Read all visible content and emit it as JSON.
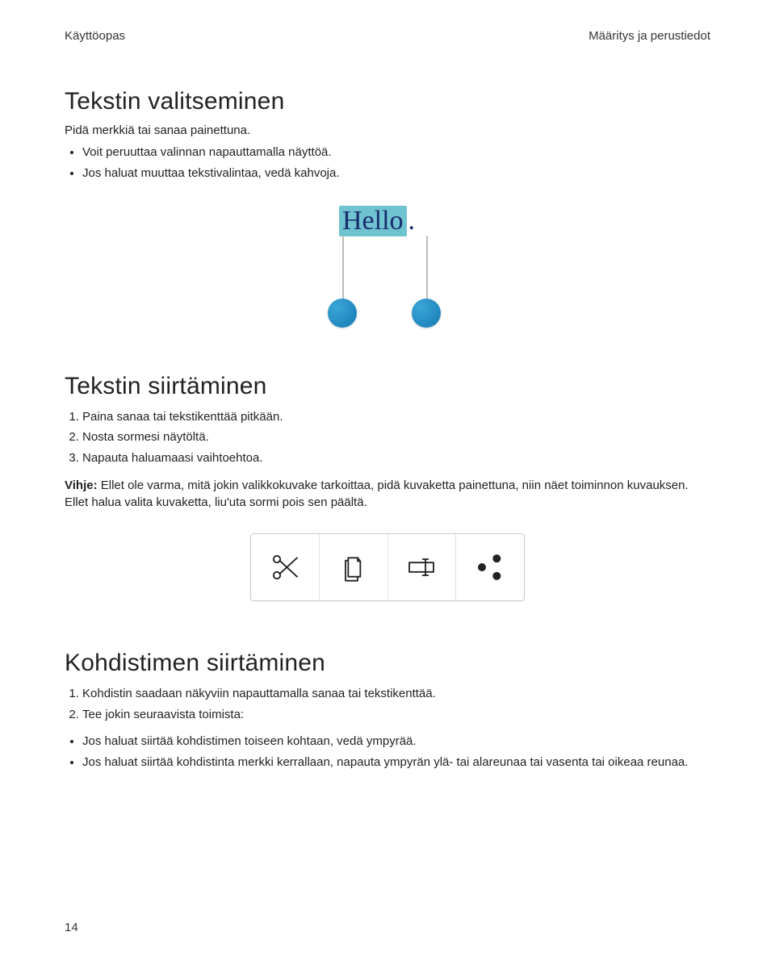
{
  "header": {
    "left": "Käyttöopas",
    "right": "Määritys ja perustiedot"
  },
  "page_number": "14",
  "sec1": {
    "title": "Tekstin valitseminen",
    "lead": "Pidä merkkiä tai sanaa painettuna.",
    "b1": "Voit peruuttaa valinnan napauttamalla näyttöä.",
    "b2": "Jos haluat muuttaa tekstivalintaa, vedä kahvoja."
  },
  "fig_hello": {
    "text": "Hello",
    "dot": "."
  },
  "sec2": {
    "title": "Tekstin siirtäminen",
    "s1": "Paina sanaa tai tekstikenttää pitkään.",
    "s2": "Nosta sormesi näytöltä.",
    "s3": "Napauta haluamaasi vaihtoehtoa.",
    "tip_label": "Vihje:",
    "tip_text": " Ellet ole varma, mitä jokin valikkokuvake tarkoittaa, pidä kuvaketta painettuna, niin näet toiminnon kuvauksen. Ellet halua valita kuvaketta, liu'uta sormi pois sen päältä."
  },
  "toolbar": {
    "cut": "cut-icon",
    "copy": "copy-icon",
    "rename": "rename-icon",
    "share": "share-icon"
  },
  "sec3": {
    "title": "Kohdistimen siirtäminen",
    "s1": "Kohdistin saadaan näkyviin napauttamalla sanaa tai tekstikenttää.",
    "s2": "Tee jokin seuraavista toimista:",
    "b1": "Jos haluat siirtää kohdistimen toiseen kohtaan, vedä ympyrää.",
    "b2": "Jos haluat siirtää kohdistinta merkki kerrallaan, napauta ympyrän ylä- tai alareunaa tai vasenta tai oikeaa reunaa."
  }
}
